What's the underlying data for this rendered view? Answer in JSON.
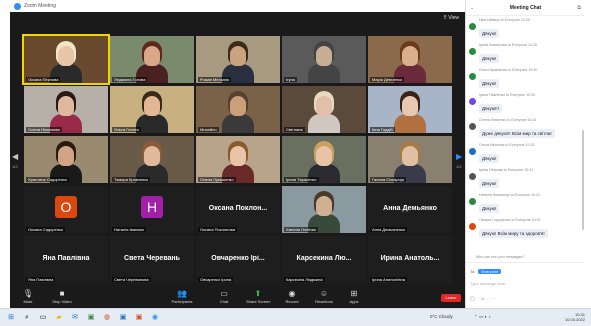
{
  "window": {
    "title": "Zoom Meeting",
    "view_label": "⠿ View"
  },
  "tiles": [
    {
      "name": "Оксана Пеклова",
      "type": "video",
      "bg": "#6a4a2e",
      "skin": "#e8c7a8",
      "shirt": "#2a2a2a",
      "hair": "#f2e6c8",
      "active": true
    },
    {
      "name": "Людмила Голова",
      "type": "video",
      "bg": "#7a8a6c",
      "skin": "#d9a88a",
      "shirt": "#4a2020",
      "hair": "#5a2a1a"
    },
    {
      "name": "Роман Мельник",
      "type": "video",
      "bg": "#a89a80",
      "skin": "#c9a27e",
      "shirt": "#2a3040",
      "hair": "#3a2a1a"
    },
    {
      "name": "Iryna",
      "type": "video",
      "bg": "#5a5a5a",
      "skin": "#c9ae94",
      "shirt": "#444",
      "hair": "#444"
    },
    {
      "name": "Марія Демченко",
      "type": "video",
      "bg": "#8a6a4a",
      "skin": "#d9b08c",
      "shirt": "#6a2a3a",
      "hair": "#6a3a1a"
    },
    {
      "name": "Олена Ніколаєва",
      "type": "video",
      "bg": "#b7b0a8",
      "skin": "#e0b8a0",
      "shirt": "#9a2a4a",
      "hair": "#2a1a12"
    },
    {
      "name": "Ольга Голота",
      "type": "video",
      "bg": "#c8b080",
      "skin": "#e2b894",
      "shirt": "#2a2a2a",
      "hair": "#3a2a1a"
    },
    {
      "name": "Михайло",
      "type": "video",
      "bg": "#7a6248",
      "skin": "#c9a07a",
      "shirt": "#3a3a3a",
      "hair": "#5a4030"
    },
    {
      "name": "Світлана",
      "type": "video",
      "bg": "#5a4a3c",
      "skin": "#e0c0a8",
      "shirt": "#d0c8c0",
      "hair": "#e8d8c0"
    },
    {
      "name": "Інна Гордій",
      "type": "video",
      "bg": "#a8b4c8",
      "skin": "#e8c8b0",
      "shirt": "#b07040",
      "hair": "#3a2418"
    },
    {
      "name": "Христина Сидоренко",
      "type": "video",
      "bg": "#9a8a70",
      "skin": "#d0a484",
      "shirt": "#1a1a1a",
      "hair": "#2a1a10"
    },
    {
      "name": "Тамара Кравченко",
      "type": "video",
      "bg": "#6a5a48",
      "skin": "#e0b89c",
      "shirt": "#2a2a2a",
      "hair": "#8a5a3a"
    },
    {
      "name": "Олена Лукашенко",
      "type": "video",
      "bg": "#b8a48a",
      "skin": "#e8c4a8",
      "shirt": "#6a2a2a",
      "hair": "#8a5a2a"
    },
    {
      "name": "Ірина Тарасенко",
      "type": "video",
      "bg": "#6a7060",
      "skin": "#e8c4a4",
      "shirt": "#2a2a30",
      "hair": "#c8a060"
    },
    {
      "name": "Галина Січкарчук",
      "type": "video",
      "bg": "#8a8070",
      "skin": "#e0c0a4",
      "shirt": "#3a3a4a",
      "hair": "#a87a4a"
    },
    {
      "name": "Оксана Сидоренко",
      "type": "letter",
      "letter": "О",
      "color": "#d9480f"
    },
    {
      "name": "Наталія Іванова",
      "type": "letter",
      "letter": "Н",
      "color": "#a020a8"
    },
    {
      "name": "Оксана Поклонова",
      "type": "text",
      "big": "Оксана Поклон..."
    },
    {
      "name": "Євгенія Олійник",
      "type": "video",
      "bg": "#8a9aa0",
      "skin": "#d0b090",
      "shirt": "#3a4a3a",
      "hair": "#4a3a2a"
    },
    {
      "name": "Анна Демьяненко",
      "type": "text",
      "big": "Анна Демьянко"
    },
    {
      "name": "Яна Павлівна",
      "type": "text",
      "big": "Яна Павлівна"
    },
    {
      "name": "Света Череванова",
      "type": "text",
      "big": "Света Черевань"
    },
    {
      "name": "Овчаренко Ірина",
      "type": "text",
      "big": "Овчаренко Ірі..."
    },
    {
      "name": "Карсекіна Людмила",
      "type": "text",
      "big": "Карсекина Лю..."
    },
    {
      "name": "Ірина Анатоліївна",
      "type": "text",
      "big": "Ирина Анатоль..."
    }
  ],
  "pages": {
    "left": "1/2",
    "right": "1/2"
  },
  "toolbar": {
    "mute": "Mute",
    "video": "Stop Video",
    "participants": "Participants",
    "participants_count": "25",
    "chat": "Chat",
    "share": "Share Screen",
    "record": "Record",
    "reactions": "Reactions",
    "apps": "Apps",
    "end": "Leave"
  },
  "chat": {
    "title": "Meeting Chat",
    "messages": [
      {
        "from": "Ніна Шевчук to Everyone 10:30",
        "text": "Дякую!",
        "color": "#2b8a3e"
      },
      {
        "from": "Ірина Ковальова to Everyone 10:30",
        "text": "Дякую!",
        "color": "#2b8a3e"
      },
      {
        "from": "Ольга Кравченко to Everyone 10:30",
        "text": "Дякую!",
        "color": "#2b8a3e"
      },
      {
        "from": "Ірина Павленко to Everyone 10:30",
        "text": "Дякую!!!",
        "color": "#7048e8"
      },
      {
        "from": "Олена Левченко to Everyone 10:31",
        "text": "Дуже дякую!!! Всім мир та світла!",
        "color": "#555555"
      },
      {
        "from": "Ольга Мельник to Everyone 10:31",
        "text": "Дякую!",
        "color": "#1971c2"
      },
      {
        "from": "Ірина Петрова to Everyone 10:31",
        "text": "Дякую!",
        "color": "#555555"
      },
      {
        "from": "Наталія Ковальчук to Everyone 10:31",
        "text": "Дякую!",
        "color": "#2b8a3e"
      },
      {
        "from": "Оксана Сидоренко to Everyone 10:31",
        "text": "Дякую! Всім миру та здоров'я!",
        "color": "#d9480f"
      }
    ],
    "who_can_see": "Who can see your messages?",
    "to_label": "To:",
    "to_value": "Everyone",
    "placeholder": "Type message here...",
    "tools": "▢ ☺ ⋯"
  },
  "taskbar": {
    "tray_temp": "0°C Cloudy",
    "time": "10:31",
    "date": "10.03.2022"
  }
}
